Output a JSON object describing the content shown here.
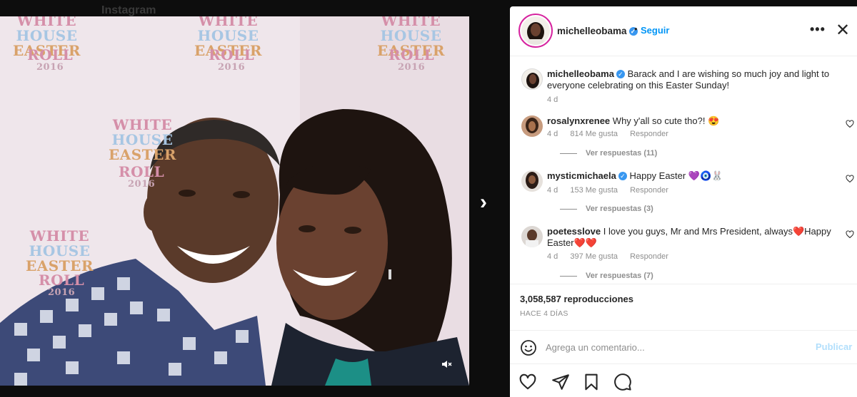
{
  "background": {
    "title": "Instagram"
  },
  "post": {
    "username": "michelleobama",
    "follow_label": "Seguir",
    "separator": "•",
    "more_label": "•••",
    "close_label": "✕",
    "caption": {
      "username": "michelleobama",
      "text": "Barack and I are wishing so much joy and light to everyone celebrating on this Easter Sunday!",
      "time": "4 d"
    },
    "media": {
      "watermark": [
        "WHITE",
        "HOUSE",
        "EASTER",
        "ROLL",
        "2016"
      ],
      "mute_icon": "speaker-mute-icon"
    },
    "next_arrow": "›"
  },
  "comments": [
    {
      "username": "rosalynxrenee",
      "verified": false,
      "text": "Why y'all so cute tho?! 😍",
      "time": "4 d",
      "likes": "814 Me gusta",
      "reply": "Responder",
      "view_replies": "Ver respuestas (11)"
    },
    {
      "username": "mysticmichaela",
      "verified": true,
      "text": "Happy Easter 💜🧿🐰",
      "time": "4 d",
      "likes": "153 Me gusta",
      "reply": "Responder",
      "view_replies": "Ver respuestas (3)"
    },
    {
      "username": "poetesslove",
      "verified": false,
      "text": "I love you guys, Mr and Mrs President, always❤️Happy Easter❤️❤️",
      "time": "4 d",
      "likes": "397 Me gusta",
      "reply": "Responder",
      "view_replies": "Ver respuestas (7)"
    }
  ],
  "stats": {
    "views": "3,058,587 reproducciones",
    "time_ago": "HACE 4 DÍAS"
  },
  "composer": {
    "placeholder": "Agrega un comentario...",
    "publish_label": "Publicar"
  },
  "colors": {
    "accent": "#0095f6",
    "publish_disabled": "#b2dffc",
    "verified": "#3897f0",
    "like_red": "#ed4956"
  }
}
